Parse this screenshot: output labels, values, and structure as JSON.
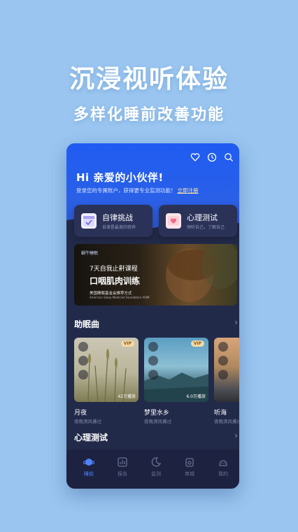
{
  "promo": {
    "title": "沉浸视听体验",
    "subtitle": "多样化睡前改善功能"
  },
  "header": {
    "icons": [
      "heart-icon",
      "clock-icon",
      "search-icon"
    ],
    "greeting": "Hi 亲爱的小伙伴!",
    "login_text": "登录您的专属账户，获得更专业监测功能！",
    "register_link": "立即注册"
  },
  "cards": [
    {
      "title": "自律挑战",
      "subtitle": "自律是最美的修养",
      "icon": "calendar-check-icon"
    },
    {
      "title": "心理测试",
      "subtitle": "倾听自己，了解自己",
      "icon": "heart-chat-icon"
    }
  ],
  "banner": {
    "brand": "蜗牛睡眠",
    "line1": "7天自我止鼾课程",
    "line2": "口咽肌肉训练",
    "line3": "美国睡眠基金会推荐方式",
    "line4": "American Sleep Medicine Foundation ASMF"
  },
  "sleep_music": {
    "title": "助眠曲",
    "items": [
      {
        "name": "月夜",
        "desc": "夜晚清风拂过",
        "plays": "42万播放",
        "vip": "VIP"
      },
      {
        "name": "梦里水乡",
        "desc": "夜晚清风拂过",
        "plays": "6.0万播放",
        "vip": "VIP"
      },
      {
        "name": "听海",
        "desc": "夜晚清风拂过",
        "plays": "",
        "vip": ""
      }
    ]
  },
  "psych_section": {
    "title": "心理测试"
  },
  "tabbar": [
    {
      "label": "睡前",
      "icon": "planet-icon",
      "active": true
    },
    {
      "label": "报告",
      "icon": "report-icon",
      "active": false
    },
    {
      "label": "监测",
      "icon": "moon-icon",
      "active": false
    },
    {
      "label": "商城",
      "icon": "shop-icon",
      "active": false
    },
    {
      "label": "我的",
      "icon": "profile-icon",
      "active": false
    }
  ],
  "colors": {
    "accent": "#1f5cf2",
    "background": "#99c5f0",
    "panel": "#222a4a"
  }
}
